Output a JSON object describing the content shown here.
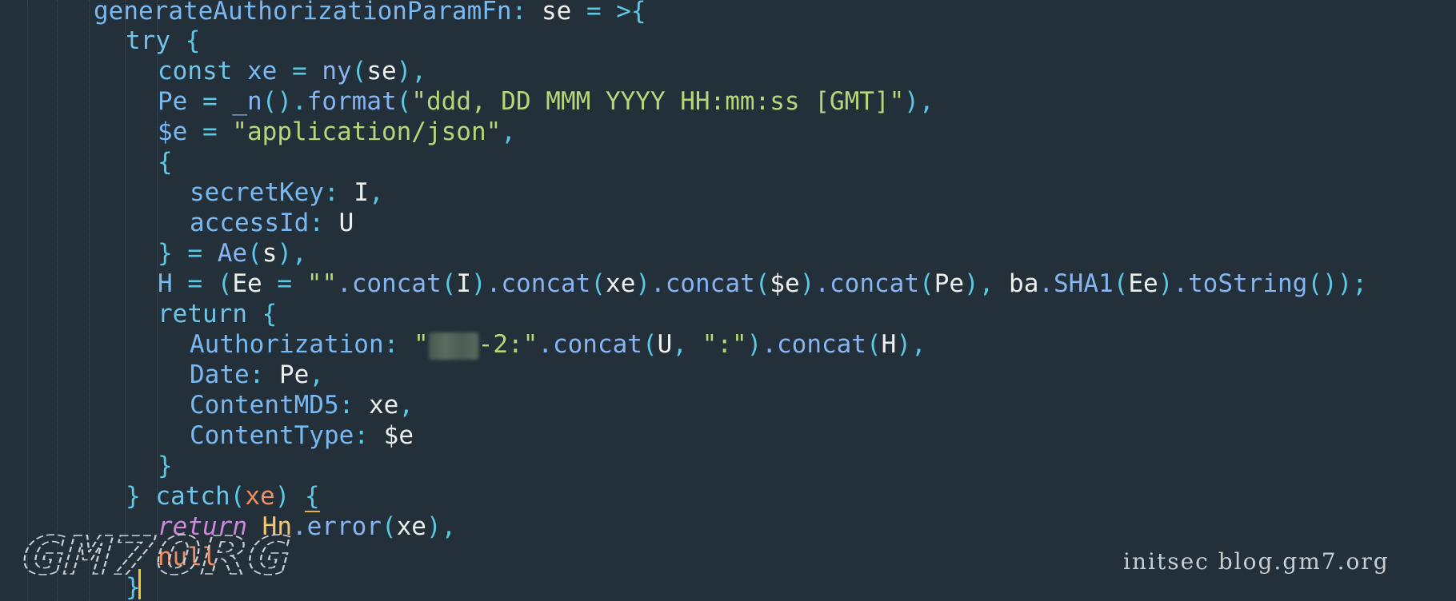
{
  "code": {
    "line1": {
      "prop": "generateAuthorizationParamFn",
      "colon": ":",
      "param": "se",
      "arrow": "= >{"
    },
    "line2": {
      "kw": "try",
      "brace": "{"
    },
    "line3": {
      "kw": "const",
      "var": "xe",
      "eq": "=",
      "fn": "ny",
      "lp": "(",
      "arg": "se",
      "rp": ")",
      "comma": ","
    },
    "line4": {
      "var": "Pe",
      "eq": "=",
      "fn": "_n",
      "call": "()",
      "dot": ".",
      "method": "format",
      "lp": "(",
      "str": "\"ddd, DD MMM YYYY HH:mm:ss [GMT]\"",
      "rp": ")",
      "comma": ","
    },
    "line5": {
      "var": "$e",
      "eq": "=",
      "str": "\"application/json\"",
      "comma": ","
    },
    "line6": {
      "brace": "{"
    },
    "line7": {
      "prop": "secretKey",
      "colon": ":",
      "val": "I",
      "comma": ","
    },
    "line8": {
      "prop": "accessId",
      "colon": ":",
      "val": "U"
    },
    "line9": {
      "brace": "}",
      "eq": "=",
      "fn": "Ae",
      "lp": "(",
      "arg": "s",
      "rp": ")",
      "comma": ","
    },
    "line10": {
      "var": "H",
      "eq": "=",
      "lp": "(",
      "ee": "Ee",
      "eq2": "=",
      "empty": "\"\"",
      "c1": ".concat",
      "a1": "I",
      "c2": ".concat",
      "a2": "xe",
      "c3": ".concat",
      "a3": "$e",
      "c4": ".concat",
      "a4": "Pe",
      "comma": ",",
      "ba": "ba",
      "sha": ".SHA1",
      "a5": "Ee",
      "tostr": ".toString",
      "end": "());"
    },
    "line11": {
      "kw": "return",
      "brace": "{"
    },
    "line12": {
      "prop": "Authorization",
      "colon": ":",
      "str_open": "\"",
      "str_rest": "-2:\"",
      "c1": ".concat",
      "a1": "U",
      "comma": ",",
      "str2": "\":\"",
      "c2": ".concat",
      "a2": "H",
      "end": "),"
    },
    "line13": {
      "prop": "Date",
      "colon": ":",
      "val": "Pe",
      "comma": ","
    },
    "line14": {
      "prop": "ContentMD5",
      "colon": ":",
      "val": "xe",
      "comma": ","
    },
    "line15": {
      "prop": "ContentType",
      "colon": ":",
      "val": "$e"
    },
    "line16": {
      "brace": "}"
    },
    "line17": {
      "brace": "}",
      "kw": "catch",
      "lp": "(",
      "param": "xe",
      "rp": ")",
      "brace2": "{"
    },
    "line18": {
      "kw": "return",
      "cls": "Hn",
      "method": ".error",
      "lp": "(",
      "arg": "xe",
      "end": "),"
    },
    "line19": {
      "val": "null"
    },
    "line20": {
      "brace": "}"
    }
  },
  "watermark": "initsec blog.gm7.org",
  "logo_text": "GM7ORG",
  "colors": {
    "background": "#232f39",
    "property": "#79b8f0",
    "keyword": "#6fc4e8",
    "function": "#86b5f2",
    "string": "#b5d77a",
    "parameter": "#ef8f63",
    "class": "#f6c570",
    "return": "#cc88dd",
    "caret": "#f6c531"
  }
}
